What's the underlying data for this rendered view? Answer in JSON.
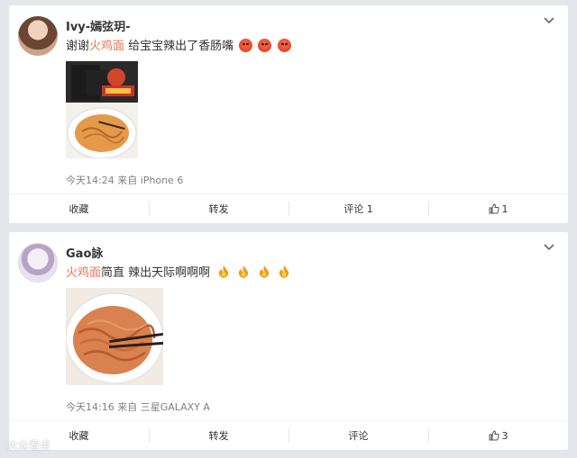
{
  "posts": [
    {
      "username": "Ivy-嫣弦玥-",
      "text_before": "谢谢",
      "highlight": "火鸡面",
      "text_after": " 给宝宝辣出了香肠嘴",
      "emoji": [
        "angry-face-icon",
        "angry-face-icon",
        "angry-face-icon"
      ],
      "meta": "今天14:24 来自 iPhone 6",
      "actions": {
        "collect": "收藏",
        "repost": "转发",
        "comment": "评论 1",
        "like": "1"
      }
    },
    {
      "username": "Gao詠",
      "text_before": "",
      "highlight": "火鸡面",
      "text_after": "简直 辣出天际啊啊啊",
      "emoji": [
        "fire-icon",
        "fire-icon",
        "fire-icon",
        "fire-icon"
      ],
      "meta": "今天14:16 来自 三星GALAXY A",
      "actions": {
        "collect": "收藏",
        "repost": "转发",
        "comment": "评论",
        "like": "3"
      }
    }
  ],
  "watermark": "大众看点",
  "colors": {
    "highlight": "#eb7350",
    "background": "#e3e6ea"
  }
}
